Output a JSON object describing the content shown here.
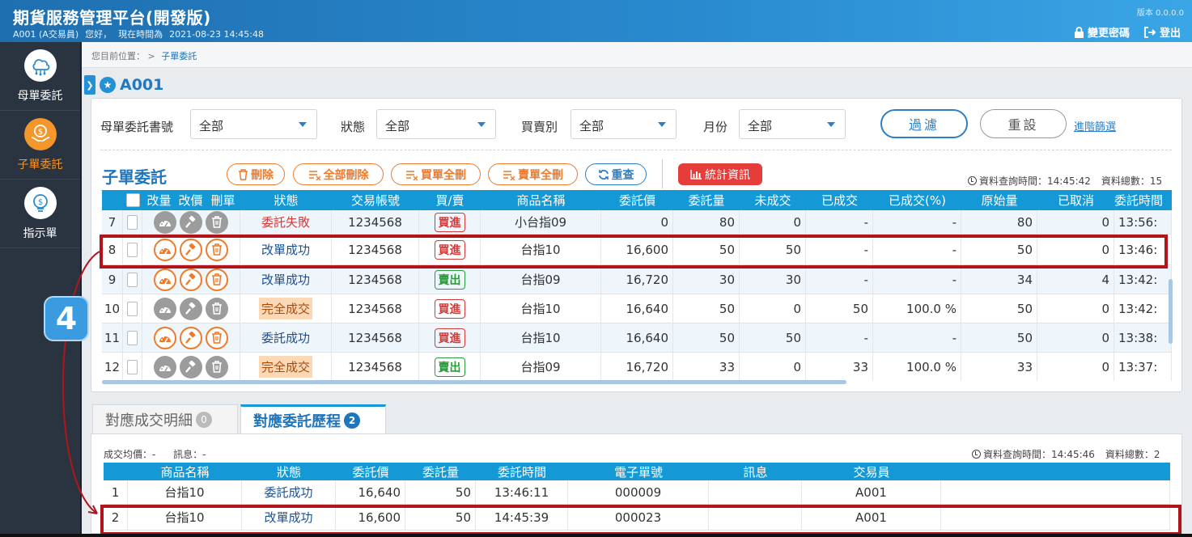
{
  "header": {
    "title": "期貨服務管理平台(開發版)",
    "account": "A001 (A交易員)",
    "greeting": "您好，",
    "time_label": "現在時間為",
    "time_value": "2021-08-23 14:45:48",
    "version": "版本 0.0.0.0",
    "change_password": "變更密碼",
    "logout": "登出"
  },
  "sidebar": {
    "items": [
      {
        "label": "母單委託",
        "icon": "network-cloud-icon"
      },
      {
        "label": "子單委託",
        "icon": "money-hand-icon",
        "active": true
      },
      {
        "label": "指示單",
        "icon": "money-bulb-icon"
      }
    ]
  },
  "breadcrumb": {
    "prefix": "您目前位置：",
    "sep": ">",
    "current": "子單委託"
  },
  "page": {
    "name": "A001"
  },
  "filters": {
    "parent_no_label": "母單委託書號",
    "parent_no_value": "全部",
    "status_label": "狀態",
    "status_value": "全部",
    "side_label": "買賣別",
    "side_value": "全部",
    "month_label": "月份",
    "month_value": "全部",
    "filter_btn": "過濾",
    "reset_btn": "重設",
    "advanced_link": "進階篩選"
  },
  "section": {
    "title": "子單委託",
    "delete": "刪除",
    "delete_all": "全部刪除",
    "buy_delete_all": "買單全刪",
    "sell_delete_all": "賣單全刪",
    "requery": "重查",
    "stats": "統計資訊",
    "query_time": "資料查詢時間：14:45:42",
    "total": "資料總數：15"
  },
  "main_table": {
    "headers": [
      "",
      "",
      "改量",
      "改價",
      "刪單",
      "狀態",
      "交易帳號",
      "買/賣",
      "商品名稱",
      "委託價",
      "委託量",
      "未成交",
      "已成交",
      "已成交(%)",
      "原始量",
      "已取消",
      "委託時間"
    ],
    "rows": [
      {
        "no": "7",
        "active": false,
        "status": "委託失敗",
        "status_type": "fail",
        "account": "1234568",
        "side": "買進",
        "side_type": "buy",
        "product": "小台指09",
        "price": "0",
        "qty": "80",
        "unfilled": "0",
        "filled": "-",
        "filled_pct": "-",
        "orig_qty": "80",
        "cancelled": "0",
        "time": "13:56:"
      },
      {
        "no": "8",
        "active": true,
        "status": "改單成功",
        "status_type": "ok",
        "account": "1234568",
        "side": "買進",
        "side_type": "buy",
        "product": "台指10",
        "price": "16,600",
        "qty": "50",
        "unfilled": "50",
        "filled": "-",
        "filled_pct": "-",
        "orig_qty": "50",
        "cancelled": "0",
        "time": "13:46:"
      },
      {
        "no": "9",
        "active": true,
        "status": "改單成功",
        "status_type": "ok",
        "account": "1234568",
        "side": "賣出",
        "side_type": "sell",
        "product": "台指09",
        "price": "16,720",
        "qty": "30",
        "unfilled": "30",
        "filled": "-",
        "filled_pct": "-",
        "orig_qty": "34",
        "cancelled": "4",
        "time": "13:42:"
      },
      {
        "no": "10",
        "active": false,
        "status": "完全成交",
        "status_type": "done",
        "account": "1234568",
        "side": "買進",
        "side_type": "buy",
        "product": "台指10",
        "price": "16,640",
        "qty": "50",
        "unfilled": "0",
        "filled": "50",
        "filled_pct": "100.0 %",
        "orig_qty": "50",
        "cancelled": "0",
        "time": "13:42:"
      },
      {
        "no": "11",
        "active": true,
        "status": "委託成功",
        "status_type": "ok",
        "account": "1234568",
        "side": "買進",
        "side_type": "buy",
        "product": "台指10",
        "price": "16,640",
        "qty": "50",
        "unfilled": "50",
        "filled": "-",
        "filled_pct": "-",
        "orig_qty": "50",
        "cancelled": "0",
        "time": "13:38:"
      },
      {
        "no": "12",
        "active": false,
        "status": "完全成交",
        "status_type": "done",
        "account": "1234568",
        "side": "賣出",
        "side_type": "sell",
        "product": "台指09",
        "price": "16,720",
        "qty": "33",
        "unfilled": "0",
        "filled": "33",
        "filled_pct": "100.0 %",
        "orig_qty": "33",
        "cancelled": "0",
        "time": "13:37:"
      }
    ]
  },
  "tabs": [
    {
      "label": "對應成交明細",
      "count": "0"
    },
    {
      "label": "對應委託歷程",
      "count": "2",
      "active": true
    }
  ],
  "sub_info": {
    "avg_price": "成交均價：-",
    "message": "訊息：-",
    "query_time": "資料查詢時間：14:45:46",
    "total": "資料總數：2"
  },
  "sub_table": {
    "headers": [
      "",
      "商品名稱",
      "狀態",
      "委託價",
      "委託量",
      "委託時間",
      "電子單號",
      "訊息",
      "交易員"
    ],
    "rows": [
      {
        "no": "1",
        "product": "台指10",
        "status": "委託成功",
        "price": "16,640",
        "qty": "50",
        "time": "13:46:11",
        "eno": "000009",
        "msg": "",
        "trader": "A001"
      },
      {
        "no": "2",
        "product": "台指10",
        "status": "改單成功",
        "price": "16,600",
        "qty": "50",
        "time": "14:45:39",
        "eno": "000023",
        "msg": "",
        "trader": "A001"
      }
    ]
  },
  "annotation": {
    "step": "4"
  },
  "colors": {
    "header": "#2a8bd0",
    "sidebar": "#293440",
    "accent": "#f3962b",
    "table_head": "#1599d6",
    "highlight": "#b0151b"
  }
}
